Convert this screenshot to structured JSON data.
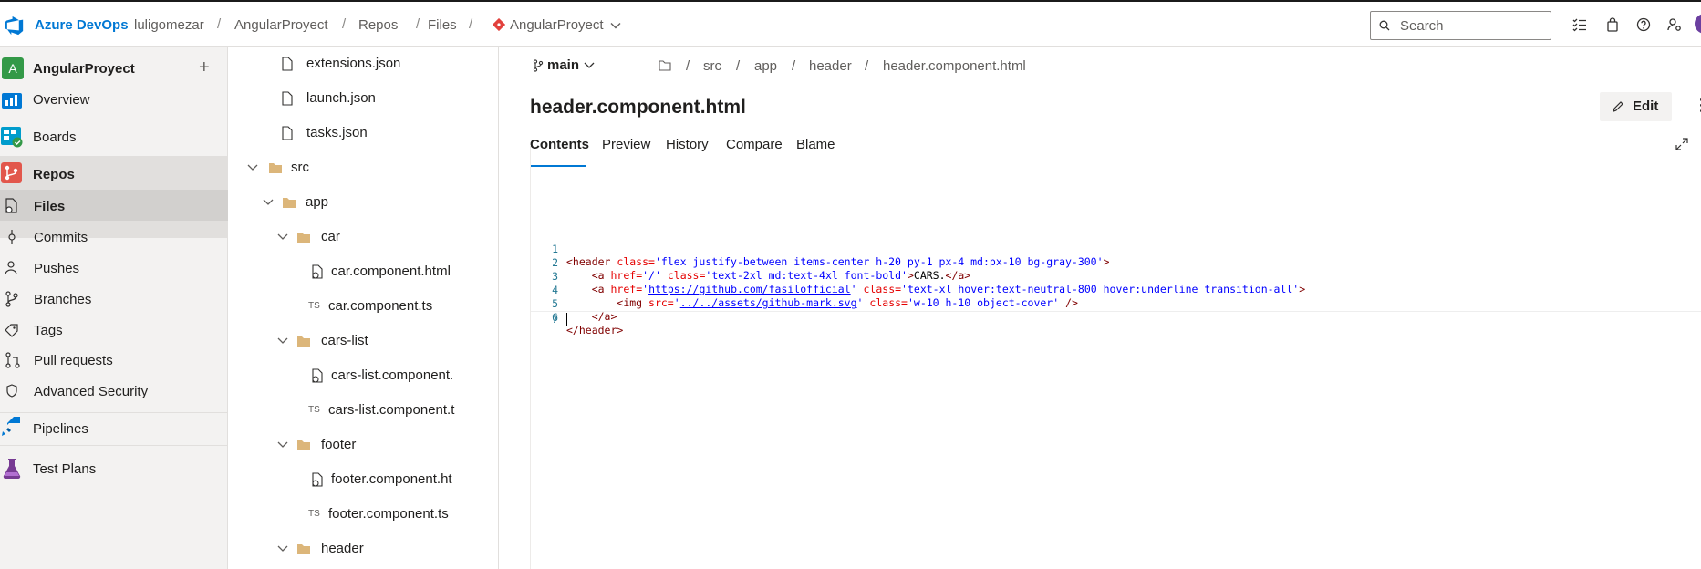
{
  "colors": {
    "brand": "#0078d4",
    "project_badge": "#339947",
    "nav_bg": "#f3f2f1",
    "active_bg": "#e1dfdd"
  },
  "topbar": {
    "brand": "Azure DevOps",
    "org": "luligomezar",
    "project": "AngularProyect",
    "section": "Repos",
    "page": "Files",
    "repo": "AngularProyect",
    "search_placeholder": "Search",
    "icons": [
      "checklist-icon",
      "shopping-bag-icon",
      "help-icon",
      "user-settings-icon"
    ]
  },
  "leftnav": {
    "project_initial": "A",
    "project_name": "AngularProyect",
    "add_label": "+",
    "items": [
      {
        "label": "Overview",
        "icon": "overview-icon"
      },
      {
        "label": "Boards",
        "icon": "boards-icon"
      },
      {
        "label": "Repos",
        "icon": "repos-icon"
      },
      {
        "label": "Files",
        "icon": "files-icon"
      },
      {
        "label": "Commits",
        "icon": "commits-icon"
      },
      {
        "label": "Pushes",
        "icon": "pushes-icon"
      },
      {
        "label": "Branches",
        "icon": "branches-icon"
      },
      {
        "label": "Tags",
        "icon": "tags-icon"
      },
      {
        "label": "Pull requests",
        "icon": "pull-requests-icon"
      },
      {
        "label": "Advanced Security",
        "icon": "shield-icon"
      },
      {
        "label": "Pipelines",
        "icon": "pipelines-icon"
      },
      {
        "label": "Test Plans",
        "icon": "test-plans-icon"
      }
    ]
  },
  "tree": {
    "items": [
      {
        "label": "extensions.json",
        "type": "file"
      },
      {
        "label": "launch.json",
        "type": "file"
      },
      {
        "label": "tasks.json",
        "type": "file"
      },
      {
        "label": "src",
        "type": "folder"
      },
      {
        "label": "app",
        "type": "folder"
      },
      {
        "label": "car",
        "type": "folder"
      },
      {
        "label": "car.component.html",
        "type": "html"
      },
      {
        "label": "car.component.ts",
        "type": "ts"
      },
      {
        "label": "cars-list",
        "type": "folder"
      },
      {
        "label": "cars-list.component.",
        "type": "html"
      },
      {
        "label": "cars-list.component.t",
        "type": "ts"
      },
      {
        "label": "footer",
        "type": "folder"
      },
      {
        "label": "footer.component.ht",
        "type": "html"
      },
      {
        "label": "footer.component.ts",
        "type": "ts"
      },
      {
        "label": "header",
        "type": "folder"
      }
    ],
    "ts_badge": "TS"
  },
  "main": {
    "branch": "main",
    "path": [
      "src",
      "app",
      "header",
      "header.component.html"
    ],
    "path_sep": "/",
    "file_title": "header.component.html",
    "edit_label": "Edit",
    "more_label": "⋮",
    "tabs": [
      "Contents",
      "Preview",
      "History",
      "Compare",
      "Blame"
    ],
    "code": {
      "line_numbers": [
        "1",
        "2",
        "3",
        "4",
        "5",
        "6",
        "7"
      ],
      "l1": {
        "open": "<header",
        "attr": "class=",
        "val": "'flex justify-between items-center h-20 py-1 px-4 md:px-10 bg-gray-300'",
        "close": ">"
      },
      "l2": {
        "indent": "    ",
        "open": "<a",
        "attr1": "href=",
        "val1": "'/'",
        "attr2": "class=",
        "val2": "'text-2xl md:text-4xl font-bold'",
        "close": ">",
        "text": "CARS.",
        "end": "</a>"
      },
      "l3": {
        "indent": "    ",
        "open": "<a",
        "attr1": "href=",
        "q1": "'",
        "link": "https://github.com/fasilofficial",
        "q2": "'",
        "attr2": "class=",
        "val2": "'text-xl hover:text-neutral-800 hover:underline transition-all'",
        "close": ">"
      },
      "l4": {
        "indent": "        ",
        "open": "<img",
        "attr1": "src=",
        "q1": "'",
        "link": "../../assets/github-mark.svg",
        "q2": "'",
        "attr2": "class=",
        "val2": "'w-10 h-10 object-cover'",
        "close": "/>"
      },
      "l5": {
        "indent": "    ",
        "end": "</a>"
      },
      "l6": {
        "end": "</header>"
      }
    }
  }
}
